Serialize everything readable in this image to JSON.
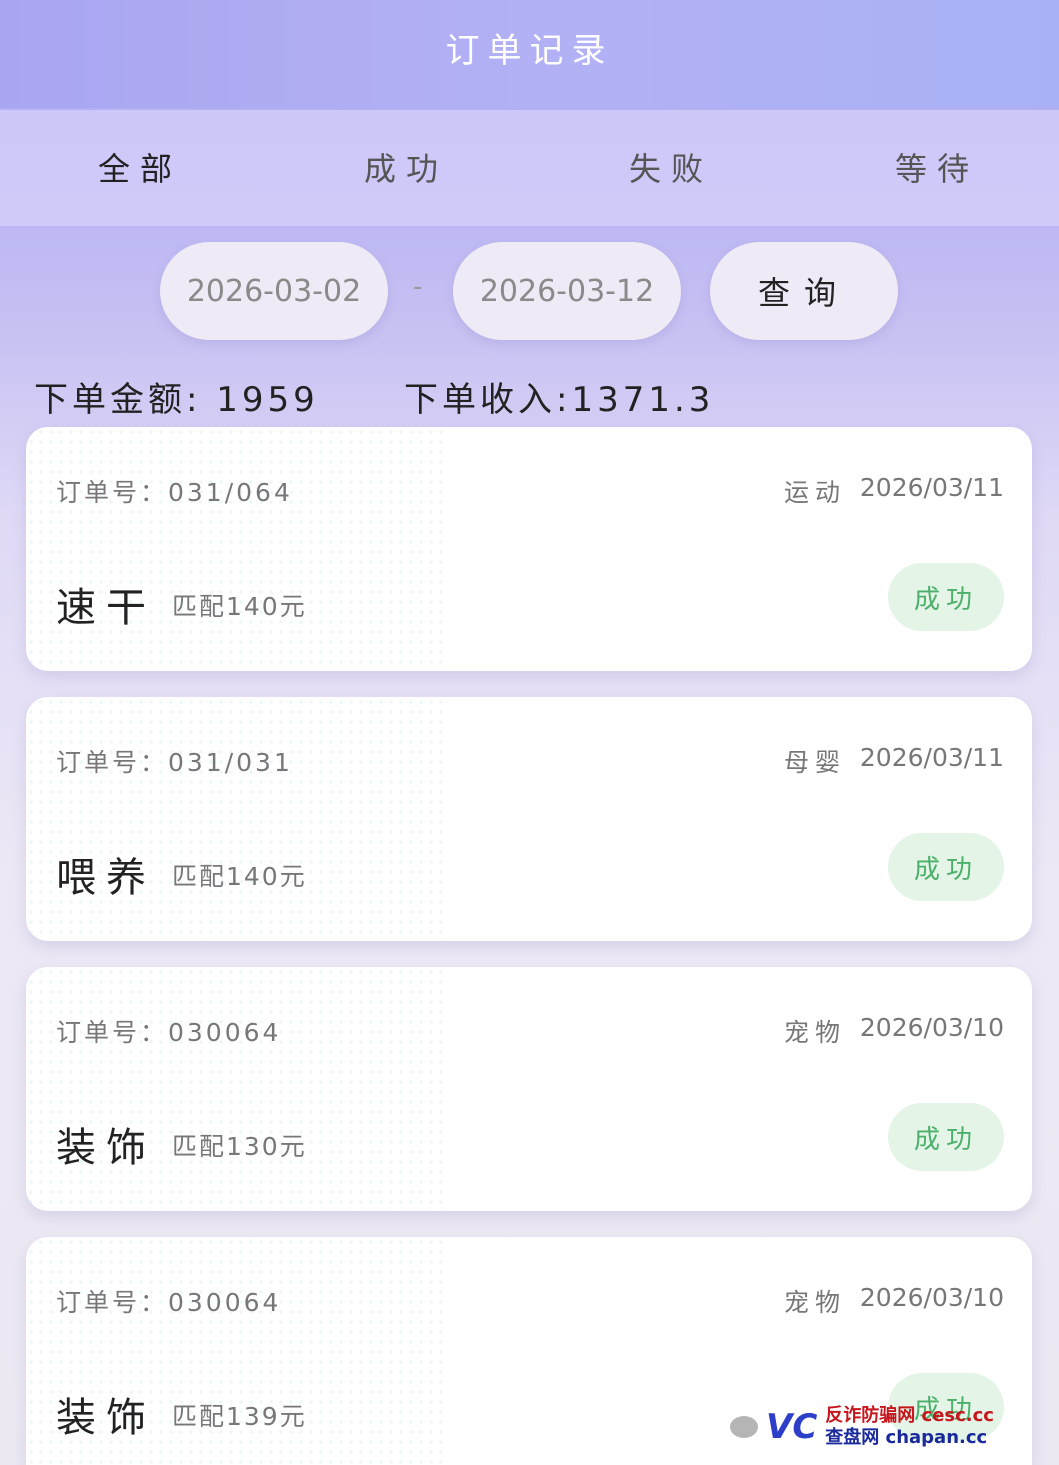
{
  "header": {
    "title": "订单记录"
  },
  "tabs": [
    {
      "label": "全部",
      "active": true
    },
    {
      "label": "成功",
      "active": false
    },
    {
      "label": "失败",
      "active": false
    },
    {
      "label": "等待",
      "active": false
    }
  ],
  "filter": {
    "start_date": "2026-03-02",
    "separator": "-",
    "end_date": "2026-03-12",
    "query_label": "查询"
  },
  "summary": {
    "amount": "下单金额: 1959",
    "income": "下单收入:1371.3"
  },
  "orders": [
    {
      "order_no": "订单号：031/064",
      "category": "运动",
      "date": "2026/03/11",
      "product": "速干",
      "match": "匹配140元",
      "status": "成功"
    },
    {
      "order_no": "订单号：031/031",
      "category": "母婴",
      "date": "2026/03/11",
      "product": "喂养",
      "match": "匹配140元",
      "status": "成功"
    },
    {
      "order_no": "订单号：030064",
      "category": "宠物",
      "date": "2026/03/10",
      "product": "装饰",
      "match": "匹配130元",
      "status": "成功"
    },
    {
      "order_no": "订单号：030064",
      "category": "宠物",
      "date": "2026/03/10",
      "product": "装饰",
      "match": "匹配139元",
      "status": "成功"
    }
  ],
  "watermark": {
    "logo": "VC",
    "line1": "反诈防骗网 cesc.cc",
    "line2": "查盘网 chapan.cc"
  },
  "colors": {
    "status_success": "#4caf6a",
    "status_bg": "#e4f5e8",
    "header_bg": "#b0adf4"
  },
  "icons": [
    "wechat-icon"
  ]
}
